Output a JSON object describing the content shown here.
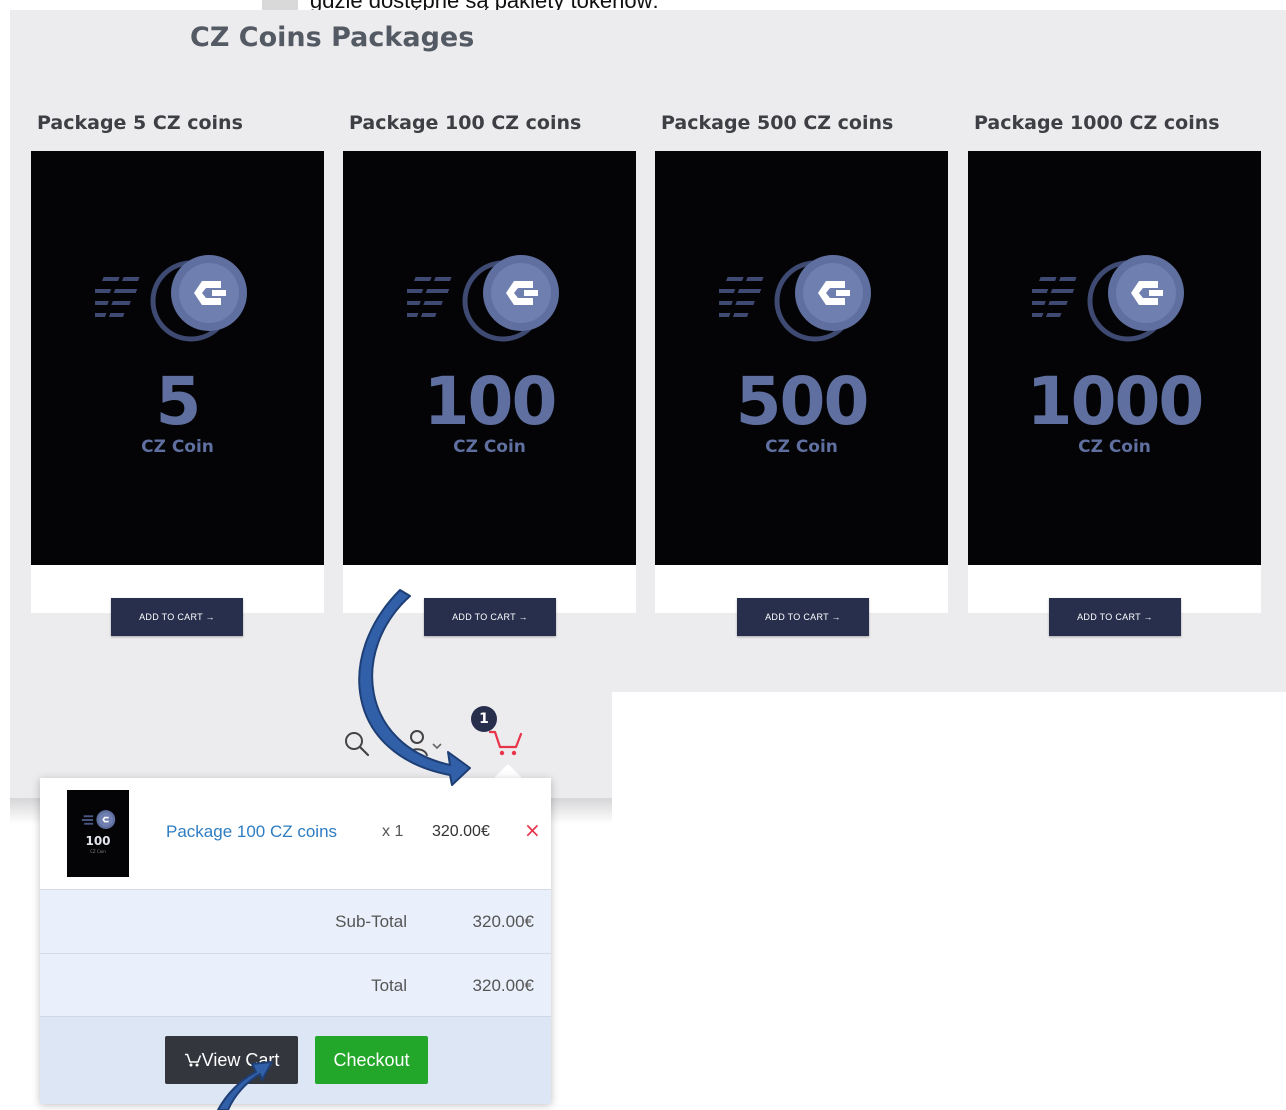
{
  "caption": {
    "text": "gdzie dostępne są pakiety tokenów:"
  },
  "section": {
    "title": "CZ Coins Packages"
  },
  "packages": [
    {
      "title": "Package 5 CZ coins",
      "amount": "5",
      "unit": "CZ Coin",
      "button": "ADD TO CART →"
    },
    {
      "title": "Package 100 CZ coins",
      "amount": "100",
      "unit": "CZ Coin",
      "button": "ADD TO CART →"
    },
    {
      "title": "Package 500 CZ coins",
      "amount": "500",
      "unit": "CZ Coin",
      "button": "ADD TO CART →"
    },
    {
      "title": "Package 1000 CZ coins",
      "amount": "1000",
      "unit": "CZ Coin",
      "button": "ADD TO CART →"
    }
  ],
  "header": {
    "icons": [
      "search-icon",
      "user-icon",
      "cart-icon"
    ],
    "cart_count": "1"
  },
  "mini_cart": {
    "item": {
      "thumb_amount": "100",
      "thumb_unit": "CZ Coin",
      "name": "Package 100 CZ coins",
      "qty": "x 1",
      "price": "320.00€",
      "remove": "×"
    },
    "subtotal_label": "Sub-Total",
    "subtotal_value": "320.00€",
    "total_label": "Total",
    "total_value": "320.00€",
    "view_cart_label": "View Cart",
    "checkout_label": "Checkout"
  },
  "colors": {
    "store_bg": "#ececee",
    "card_bg": "#040407",
    "coin_accent": "#5f6f9f",
    "button_navy": "#272f4d",
    "cart_red": "#e8344a",
    "checkout_green": "#22a72a",
    "link_blue": "#2e7dc2",
    "annotation_arrow": "#2f5597"
  }
}
